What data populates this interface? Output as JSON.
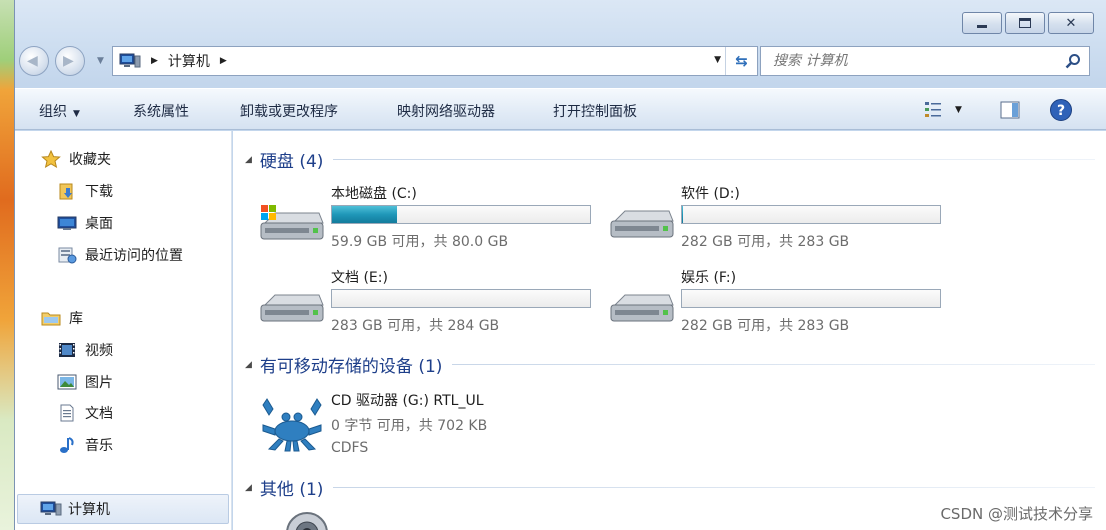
{
  "colors": {
    "accent": "#1e3f8a",
    "bar_fill": "#1f97b8",
    "muted_text": "#6d6d6d"
  },
  "address": {
    "path": "计算机"
  },
  "search": {
    "placeholder": "搜索 计算机"
  },
  "toolbar": {
    "organize": "组织",
    "system_properties": "系统属性",
    "uninstall": "卸载或更改程序",
    "map_drive": "映射网络驱动器",
    "control_panel": "打开控制面板"
  },
  "sidebar": {
    "favorites": "收藏夹",
    "downloads": "下载",
    "desktop": "桌面",
    "recent": "最近访问的位置",
    "libraries": "库",
    "videos": "视频",
    "pictures": "图片",
    "documents": "文档",
    "music": "音乐",
    "computer": "计算机"
  },
  "groups": {
    "hard_disks": "硬盘 (4)",
    "removable": "有可移动存储的设备 (1)",
    "other": "其他 (1)"
  },
  "drives": [
    {
      "name": "本地磁盘 (C:)",
      "size": "59.9 GB 可用，共 80.0 GB",
      "used_fraction": 0.25
    },
    {
      "name": "软件 (D:)",
      "size": "282 GB 可用，共 283 GB",
      "used_fraction": 0.004
    },
    {
      "name": "文档 (E:)",
      "size": "283 GB 可用，共 284 GB",
      "used_fraction": 0.0
    },
    {
      "name": "娱乐 (F:)",
      "size": "282 GB 可用，共 283 GB",
      "used_fraction": 0.0
    }
  ],
  "cd_drive": {
    "name": "CD 驱动器 (G:) RTL_UL",
    "size": "0 字节 可用，共 702 KB",
    "fs": "CDFS"
  },
  "watermark": "CSDN @测试技术分享"
}
